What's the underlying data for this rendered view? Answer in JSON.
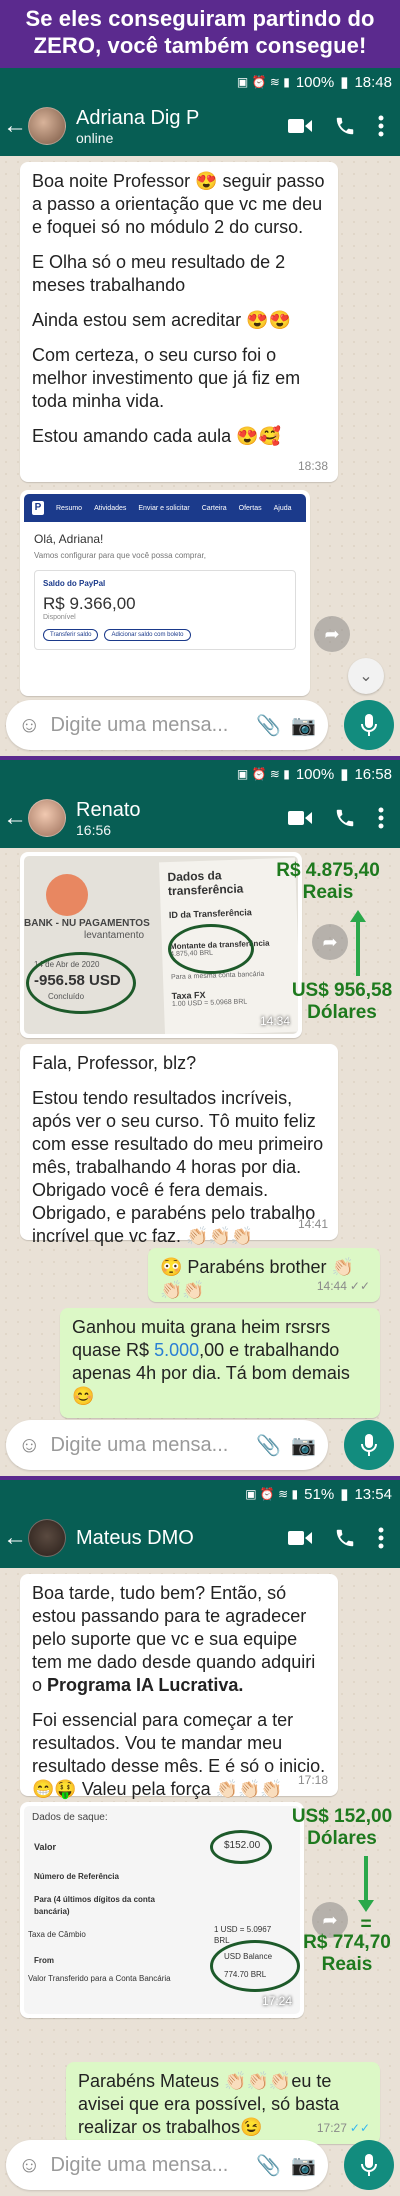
{
  "banner": {
    "line1": "Se eles conseguiram partindo do",
    "line2": "ZERO, você também consegue!"
  },
  "status": {
    "s1": {
      "battery": "100%",
      "time": "18:48"
    },
    "s2": {
      "battery": "100%",
      "time": "16:58"
    },
    "s3": {
      "battery": "51%",
      "time": "13:54"
    }
  },
  "chats": {
    "c1": {
      "name": "Adriana Dig P",
      "subtitle": "online",
      "msg1": {
        "p1": "Boa noite Professor 😍 seguir passo a passo a orientação que vc me deu e foquei só no módulo 2 do curso.",
        "p2": "E Olha só o meu resultado de 2 meses trabalhando",
        "p3": "Ainda estou sem acreditar 😍😍",
        "p4": "Com certeza, o seu curso foi o melhor investimento que já fiz em toda minha vida.",
        "p5": "Estou amando cada aula 😍🥰",
        "time": "18:38"
      },
      "paypal": {
        "logo": "P",
        "nav": [
          "Resumo",
          "Atividades",
          "Enviar e solicitar",
          "Carteira",
          "Ofertas",
          "Ajuda"
        ],
        "greeting": "Olá, Adriana!",
        "intro": "Vamos configurar para que você possa comprar,",
        "balance_label": "Saldo do PayPal",
        "balance": "R$ 9.366,00",
        "available": "Disponível",
        "btn1": "Transferir saldo",
        "btn2": "Adicionar saldo com boleto"
      },
      "placeholder": "Digite uma mensa..."
    },
    "c2": {
      "name": "Renato",
      "subtitle": "16:56",
      "image": {
        "title": "Dados da transferência",
        "bank": "BANK - NU PAGAMENTOS",
        "op": "levantamento",
        "date": "14 de Abr de 2020",
        "amount": "-956.58 USD",
        "status": "Concluído",
        "id_label": "ID da Transferência",
        "montante_label": "Montante da transferência",
        "montante": "4.875,40 BRL",
        "conta_label": "Para a mesma conta bancária",
        "fx_label": "Taxa FX",
        "fx": "1.00 USD = 5.0968 BRL",
        "time": "14:34"
      },
      "annot_top": "R$ 4.875,40",
      "annot_top2": "Reais",
      "annot_bottom": "US$ 956,58",
      "annot_bottom2": "Dólares",
      "msg1": {
        "p1": "Fala, Professor, blz?",
        "p2": "Estou tendo resultados incríveis, após ver o seu curso. Tô muito feliz com esse resultado do meu primeiro mês, trabalhando 4 horas por dia. Obrigado você é fera demais. Obrigado, e parabéns pelo trabalho incrível que vc faz. 👏🏻👏🏻👏🏻",
        "time": "14:41"
      },
      "msg2": {
        "text": "😳 Parabéns brother 👏🏻👏🏻👏🏻",
        "time": "14:44"
      },
      "msg3": {
        "pre": "Ganhou muita grana heim rsrsrs quase R$ ",
        "highlight": "5.000",
        "post": ",00 e trabalhando apenas 4h por dia. Tá bom demais 😊"
      },
      "placeholder": "Digite uma mensa..."
    },
    "c3": {
      "name": "Mateus DMO",
      "subtitle": "",
      "msg1": {
        "p1a": "Boa tarde, tudo bem? Então, só estou passando para te agradecer pelo suporte que vc e sua equipe tem me dado desde quando adquiri o ",
        "p1b": "Programa IA Lucrativa.",
        "p2": "Foi essencial para começar a ter resultados. Vou te mandar meu resultado desse mês. E é só o inicio. 😁🤑 Valeu pela força 👏🏻👏🏻👏🏻",
        "time": "17:18"
      },
      "image": {
        "header": "Dados de saque:",
        "valor_label": "Valor",
        "valor": "$152.00",
        "ref_label": "Número de Referência",
        "para_label": "Para (4 últimos dígitos da conta bancária)",
        "cambio_label": "Taxa de Câmbio",
        "cambio": "1 USD = 5.0967 BRL",
        "from_label": "From",
        "from": "USD Balance",
        "transfer_label": "Valor Transferido para a Conta Bancária",
        "transfer": "774.70 BRL",
        "time": "17:24"
      },
      "annot_top": "US$ 152,00",
      "annot_top2": "Dólares",
      "annot_eq": "=",
      "annot_bottom": "R$ 774,70",
      "annot_bottom2": "Reais",
      "msg2": {
        "text": "Parabéns Mateus 👏🏻👏🏻👏🏻eu te avisei que era possível, só basta realizar os trabalhos😉",
        "time": "17:27"
      },
      "placeholder": "Digite uma mensa..."
    }
  }
}
